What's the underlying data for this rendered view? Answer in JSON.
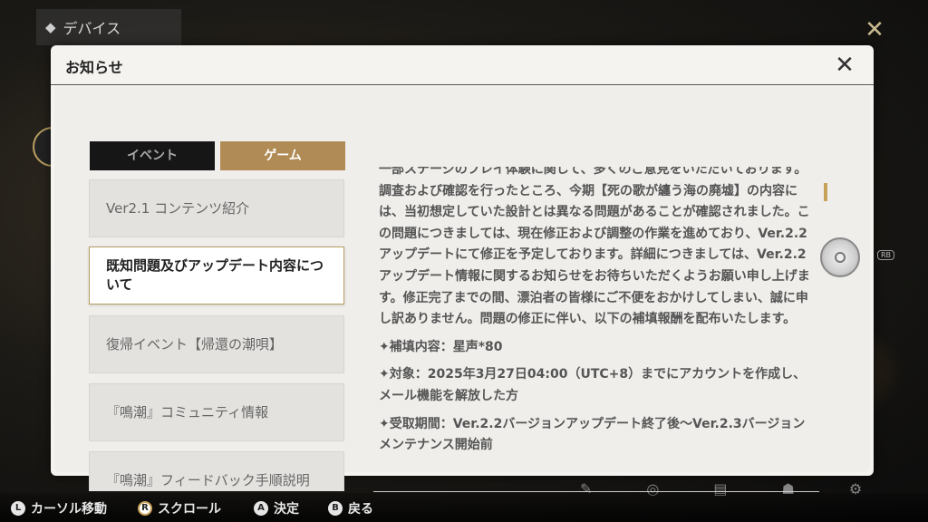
{
  "background": {
    "title": "デバイス",
    "diamond_icon": "◆",
    "close_icon": "✕",
    "bottom_icons": [
      "✎",
      "◎",
      "▤",
      "☗",
      "⚙"
    ]
  },
  "panel": {
    "title": "お知らせ",
    "close_icon": "✕"
  },
  "tabs": [
    {
      "label": "イベント",
      "active": false
    },
    {
      "label": "ゲーム",
      "active": true
    }
  ],
  "list": {
    "items": [
      {
        "label": "Ver2.1 コンテンツ紹介",
        "active": false
      },
      {
        "label": "既知問題及びアップデート内容について",
        "active": true
      },
      {
        "label": "復帰イベント【帰還の潮唄】",
        "active": false
      },
      {
        "label": "『鳴潮』コミュニティ情報",
        "active": false
      },
      {
        "label": "『鳴潮』フィードバック手順説明",
        "active": false
      }
    ]
  },
  "article": {
    "paragraphs": [
      "一部ステージのプレイ体験に関して、多くのご意見をいただいております。調査および確認を行ったところ、今期【死の歌が纏う海の廃墟】の内容には、当初想定していた設計とは異なる問題があることが確認されました。この問題につきましては、現在修正および調整の作業を進めており、Ver.2.2アップデートにて修正を予定しております。詳細につきましては、Ver.2.2アップデート情報に関するお知らせをお待ちいただくようお願い申し上げます。修正完了までの間、漂泊者の皆様にご不便をおかけしてしまい、誠に申し訳ありません。問題の修正に伴い、以下の補填報酬を配布いたします。",
      "✦補填内容：星声*80",
      "✦対象：2025年3月27日04:00（UTC+8）までにアカウントを作成し、メール機能を解放した方",
      "✦受取期間：Ver.2.2バージョンアップデート終了後～Ver.2.3バージョンメンテナンス開始前"
    ]
  },
  "rb_label": "RB",
  "footer": {
    "hints": [
      {
        "key": "L",
        "label": "カーソル移動"
      },
      {
        "key": "R",
        "label": "スクロール"
      },
      {
        "key": "A",
        "label": "決定"
      },
      {
        "key": "B",
        "label": "戻る"
      }
    ]
  },
  "colors": {
    "accent_gold": "#b08b55",
    "panel_bg": "#f4f3f0",
    "tab_dark": "#161616"
  }
}
